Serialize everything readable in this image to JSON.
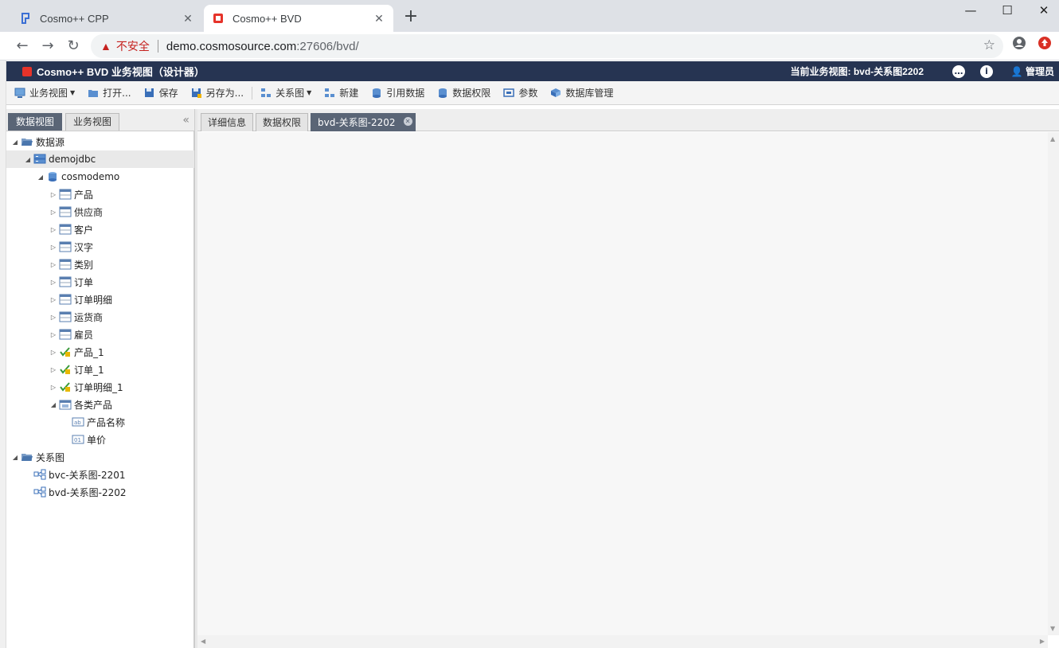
{
  "browser": {
    "tabs": [
      {
        "title": "Cosmo++ CPP",
        "active": false
      },
      {
        "title": "Cosmo++ BVD",
        "active": true
      }
    ],
    "new_tab": "+",
    "window_controls": {
      "minimize": "—",
      "maximize": "☐",
      "close": "✕"
    },
    "address": {
      "security_label": "不安全",
      "host": "demo.cosmosource.com",
      "path": ":27606/bvd/"
    }
  },
  "app": {
    "title": "Cosmo++ BVD 业务视图（设计器）",
    "current_view": "当前业务视图: bvd-关系图2202",
    "user": "管理员"
  },
  "toolbar": {
    "items": [
      {
        "label": "业务视图",
        "icon": "business-view-icon",
        "dropdown": true
      },
      {
        "label": "打开...",
        "icon": "open-folder-icon"
      },
      {
        "label": "保存",
        "icon": "save-icon"
      },
      {
        "label": "另存为...",
        "icon": "save-as-icon"
      },
      {
        "label": "关系图",
        "icon": "relation-diagram-icon",
        "dropdown": true
      },
      {
        "label": "新建",
        "icon": "new-icon"
      },
      {
        "label": "引用数据",
        "icon": "reference-data-icon"
      },
      {
        "label": "数据权限",
        "icon": "data-permission-icon"
      },
      {
        "label": "参数",
        "icon": "parameter-icon"
      },
      {
        "label": "数据库管理",
        "icon": "database-manage-icon"
      }
    ]
  },
  "left_panel": {
    "tabs": [
      "数据视图",
      "业务视图"
    ],
    "active_tab": "数据视图"
  },
  "tree": [
    {
      "label": "数据源",
      "icon": "folder-open-icon",
      "level": 0,
      "toggle": "expanded"
    },
    {
      "label": "demojdbc",
      "icon": "server-icon",
      "level": 1,
      "toggle": "expanded",
      "selected": true
    },
    {
      "label": "cosmodemo",
      "icon": "database-icon",
      "level": 2,
      "toggle": "expanded"
    },
    {
      "label": "产品",
      "icon": "table-icon",
      "level": 3,
      "toggle": "collapsed"
    },
    {
      "label": "供应商",
      "icon": "table-icon",
      "level": 3,
      "toggle": "collapsed"
    },
    {
      "label": "客户",
      "icon": "table-icon",
      "level": 3,
      "toggle": "collapsed"
    },
    {
      "label": "汉字",
      "icon": "table-icon",
      "level": 3,
      "toggle": "collapsed"
    },
    {
      "label": "类别",
      "icon": "table-icon",
      "level": 3,
      "toggle": "collapsed"
    },
    {
      "label": "订单",
      "icon": "table-icon",
      "level": 3,
      "toggle": "collapsed"
    },
    {
      "label": "订单明细",
      "icon": "table-icon",
      "level": 3,
      "toggle": "collapsed"
    },
    {
      "label": "运货商",
      "icon": "table-icon",
      "level": 3,
      "toggle": "collapsed"
    },
    {
      "label": "雇员",
      "icon": "table-icon",
      "level": 3,
      "toggle": "collapsed"
    },
    {
      "label": "产品_1",
      "icon": "query-table-icon",
      "level": 3,
      "toggle": "collapsed"
    },
    {
      "label": "订单_1",
      "icon": "query-table-icon",
      "level": 3,
      "toggle": "collapsed"
    },
    {
      "label": "订单明细_1",
      "icon": "query-table-icon",
      "level": 3,
      "toggle": "collapsed"
    },
    {
      "label": "各类产品",
      "icon": "view-icon",
      "level": 3,
      "toggle": "expanded"
    },
    {
      "label": "产品名称",
      "icon": "text-field-icon",
      "level": 4,
      "toggle": "none"
    },
    {
      "label": "单价",
      "icon": "number-field-icon",
      "level": 4,
      "toggle": "none"
    },
    {
      "label": "关系图",
      "icon": "folder-open-icon",
      "level": 0,
      "toggle": "expanded"
    },
    {
      "label": "bvc-关系图-2201",
      "icon": "relation-diagram-icon",
      "level": 1,
      "toggle": "none"
    },
    {
      "label": "bvd-关系图-2202",
      "icon": "relation-diagram-icon",
      "level": 1,
      "toggle": "none"
    }
  ],
  "right_panel": {
    "tabs": [
      {
        "label": "详细信息",
        "active": false
      },
      {
        "label": "数据权限",
        "active": false
      },
      {
        "label": "bvd-关系图-2202",
        "active": true,
        "closable": true
      }
    ]
  },
  "colors": {
    "header_bg": "#263452",
    "active_tab_bg": "#5a6576",
    "brand_red": "#e6332a"
  }
}
